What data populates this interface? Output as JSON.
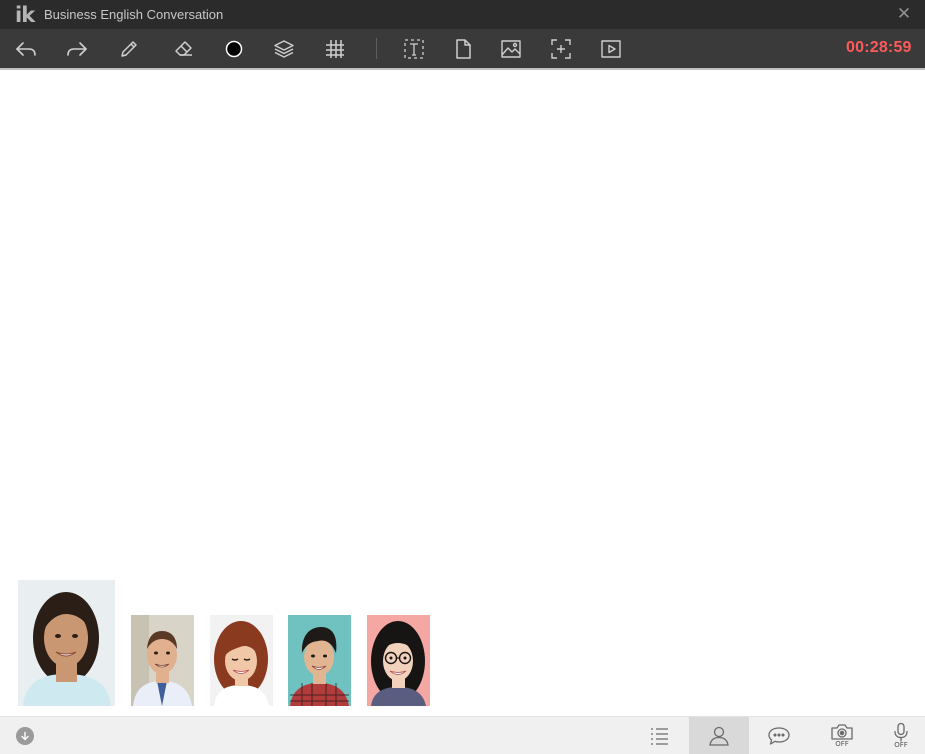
{
  "app": {
    "logo": "ik",
    "title": "Business English Conversation",
    "close_symbol": "✕"
  },
  "toolbar": {
    "timer": "00:28:59",
    "timer_color": "#ff5a5a",
    "tools": [
      {
        "name": "undo-icon"
      },
      {
        "name": "redo-icon"
      },
      {
        "name": "pencil-icon"
      },
      {
        "name": "eraser-icon"
      },
      {
        "name": "color-circle-icon"
      },
      {
        "name": "layers-icon"
      },
      {
        "name": "grid-icon"
      },
      {
        "name": "text-box-icon"
      },
      {
        "name": "document-icon"
      },
      {
        "name": "image-icon"
      },
      {
        "name": "add-frame-icon"
      },
      {
        "name": "play-video-icon"
      }
    ]
  },
  "participants": [
    {
      "name": "teacher-video",
      "bg": "#e9eef0",
      "skin": "#c99873",
      "hair": "#2a1e17",
      "shirt": "#cfe9f0"
    },
    {
      "name": "student-video-1",
      "bg": "#d8d4c8",
      "skin": "#e0b08f",
      "hair": "#5a3a26",
      "shirt": "#e9eef8"
    },
    {
      "name": "student-video-2",
      "bg": "#f2f2f2",
      "skin": "#f0c8a8",
      "hair": "#8a3a1e",
      "shirt": "#ffffff"
    },
    {
      "name": "student-video-3",
      "bg": "#6fc2bf",
      "skin": "#e2b592",
      "hair": "#1d1a18",
      "shirt": "#b23b3b"
    },
    {
      "name": "student-video-4",
      "bg": "#f5a8a3",
      "skin": "#f3d2bd",
      "hair": "#171414",
      "shirt": "#5a5d80"
    }
  ],
  "bottombar": {
    "camera_state": "OFF",
    "mic_state": "OFF",
    "active_tab": "participants"
  }
}
